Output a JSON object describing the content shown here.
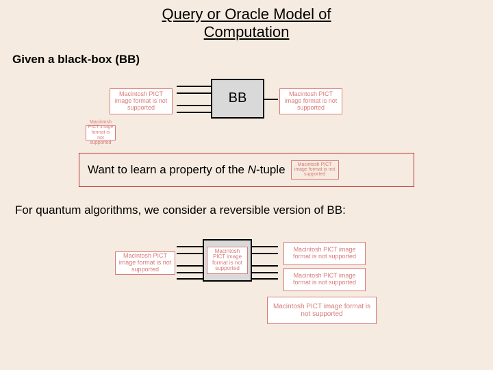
{
  "title_line1": "Query or Oracle Model of",
  "title_line2": "Computation",
  "given_line": "Given a black-box (BB)",
  "bb_label": "BB",
  "pict_text": "Macintosh PICT image format is not supported",
  "callout_prefix": "Want to learn a property of the ",
  "callout_italic": "N",
  "callout_suffix": "-tuple",
  "quantum_line": "For quantum algorithms, we consider a reversible version of BB:"
}
